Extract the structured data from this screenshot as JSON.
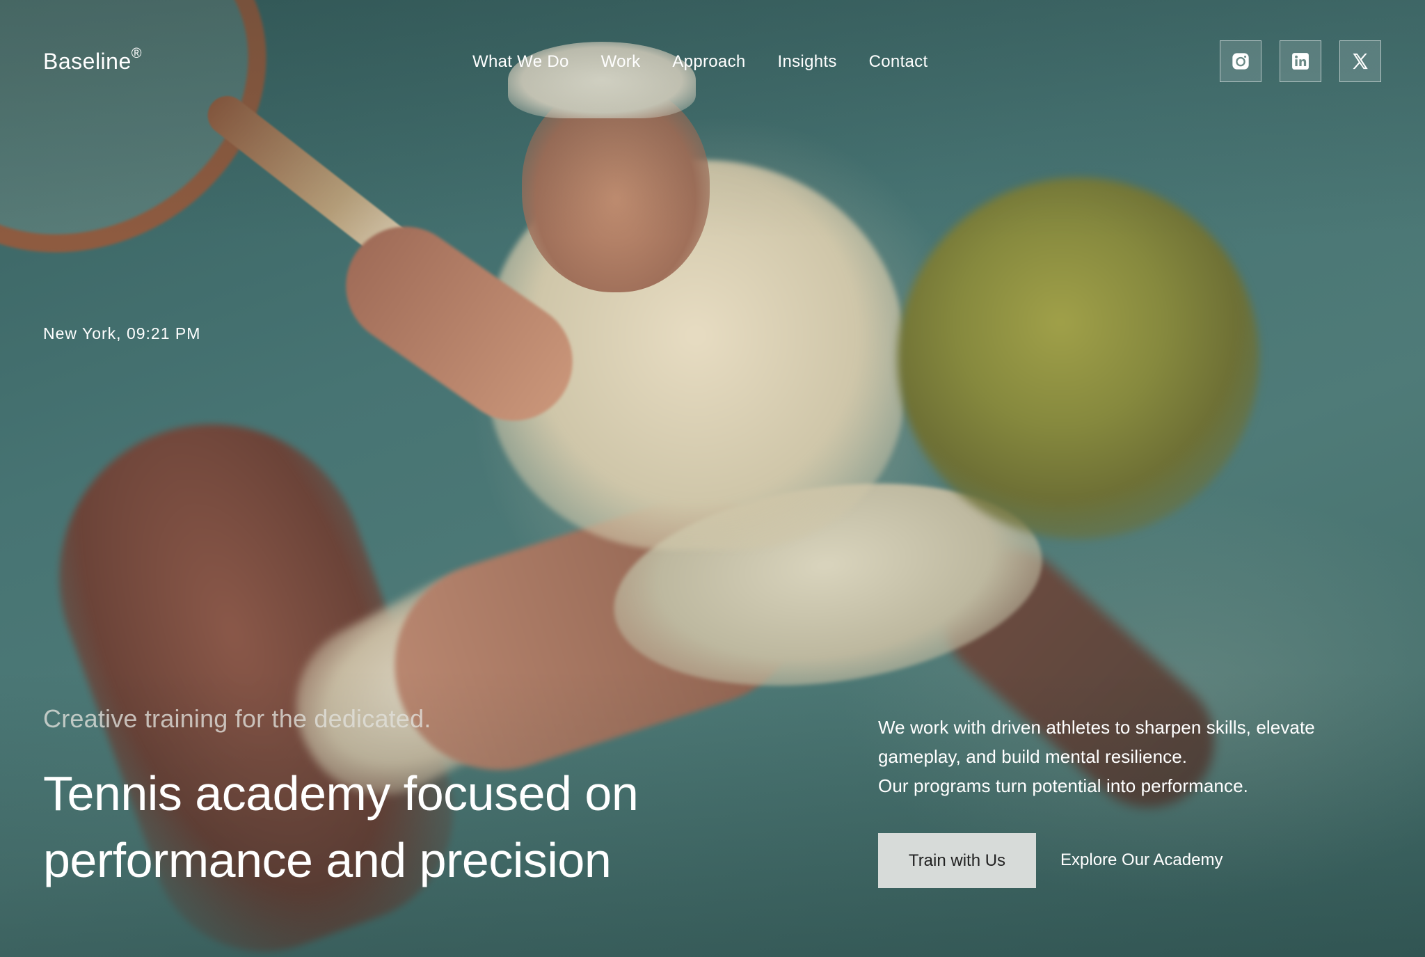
{
  "brand": {
    "name": "Baseline",
    "mark": "®"
  },
  "nav": {
    "items": [
      {
        "label": "What We Do"
      },
      {
        "label": "Work"
      },
      {
        "label": "Approach"
      },
      {
        "label": "Insights"
      },
      {
        "label": "Contact"
      }
    ]
  },
  "social": {
    "icons": [
      "instagram-icon",
      "linkedin-icon",
      "x-icon"
    ]
  },
  "hero": {
    "location_time": "New York, 09:21 PM",
    "tagline": "Creative training for the dedicated.",
    "headline_line1": "Tennis academy focused on",
    "headline_line2": "performance and precision",
    "description_line1": "We work with driven athletes to sharpen skills, elevate gameplay, and build mental resilience.",
    "description_line2": "Our programs turn potential into performance.",
    "primary_cta": "Train with Us",
    "secondary_cta": "Explore Our Academy"
  },
  "colors": {
    "background": "#3f6a6a",
    "text": "#ffffff",
    "primary_button_bg": "#d7dbd9",
    "primary_button_text": "#222222"
  }
}
